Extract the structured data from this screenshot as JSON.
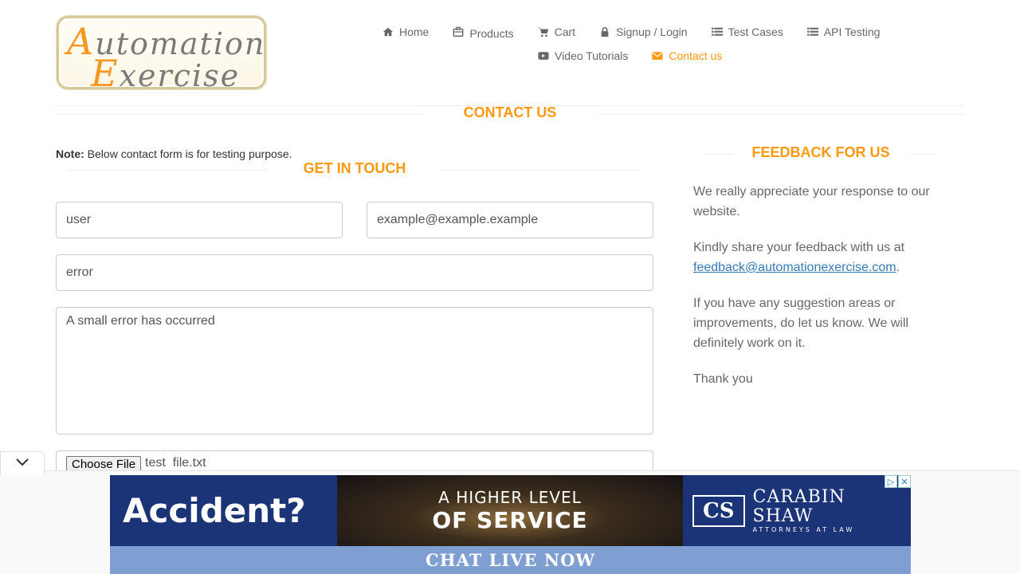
{
  "brand": {
    "logo_line1_cap": "A",
    "logo_line1_rest": "utomation",
    "logo_line2_cap": "E",
    "logo_line2_rest": "xercise"
  },
  "nav": {
    "row1": [
      {
        "label": "Home",
        "icon": "home-icon",
        "name": "nav-home"
      },
      {
        "label": "Products",
        "icon": "products-icon",
        "name": "nav-products"
      },
      {
        "label": "Cart",
        "icon": "cart-icon",
        "name": "nav-cart"
      },
      {
        "label": "Signup / Login",
        "icon": "lock-icon",
        "name": "nav-signup-login"
      },
      {
        "label": "Test Cases",
        "icon": "list-icon",
        "name": "nav-test-cases"
      },
      {
        "label": "API Testing",
        "icon": "list-icon",
        "name": "nav-api-testing"
      }
    ],
    "row2": [
      {
        "label": "Video Tutorials",
        "icon": "youtube-icon",
        "name": "nav-video-tutorials"
      },
      {
        "label": "Contact us",
        "icon": "envelope-icon",
        "name": "nav-contact-us",
        "active": true
      }
    ]
  },
  "page": {
    "title": "Contact Us",
    "note_label": "Note:",
    "note_text": " Below contact form is for testing purpose."
  },
  "form": {
    "title": "Get In Touch",
    "name_value": "user",
    "email_value": "example@example.example",
    "subject_value": "error",
    "message_value": "A small error has occurred",
    "file_button": "Choose File",
    "file_name": "test  file.txt"
  },
  "feedback": {
    "title": "Feedback For Us",
    "p1": "We really appreciate your response to our website.",
    "p2_prefix": "Kindly share your feedback with us at ",
    "p2_link": "feedback@automationexercise.com",
    "p2_suffix": ".",
    "p3": "If you have any suggestion areas or improvements, do let us know. We will definitely work on it.",
    "p4": "Thank you"
  },
  "ad": {
    "left_text": "Accident?",
    "mid_line1": "A HIGHER LEVEL",
    "mid_line2": "OF SERVICE",
    "logo_initials": "CS",
    "firm_name": "CARABIN SHAW",
    "firm_sub": "ATTORNEYS AT LAW",
    "cta": "CHAT LIVE NOW"
  },
  "colors": {
    "accent": "#fe980f",
    "link": "#337ab7",
    "ad_blue": "#1b3478",
    "ad_cta": "#7f9fd3"
  }
}
